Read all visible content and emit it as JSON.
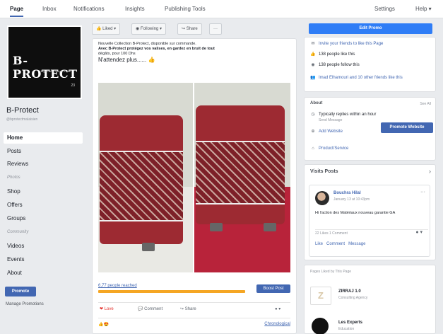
{
  "tabs": {
    "page": "Page",
    "inbox": "Inbox",
    "notifications": "Notifications",
    "insights": "Insights",
    "publishing_tools": "Publishing Tools",
    "settings": "Settings",
    "help": "Help"
  },
  "sidebar": {
    "logo_text": "B- PROTECT",
    "logo_tagline": "Huge Carry, Huge Travel",
    "logo_number": "23",
    "page_name": "B-Protect",
    "page_handle": "@bprotectmalaisien",
    "items": [
      {
        "label": "Home"
      },
      {
        "label": "Posts"
      },
      {
        "label": "Reviews"
      },
      {
        "label": "Photos"
      },
      {
        "label": "Shop"
      },
      {
        "label": "Offers"
      },
      {
        "label": "Groups"
      },
      {
        "label": "Community"
      },
      {
        "label": "Videos"
      },
      {
        "label": "Events"
      },
      {
        "label": "About"
      }
    ],
    "promote_label": "Promote",
    "manage_label": "Manage Promotions"
  },
  "action_bar": {
    "liked": "Liked",
    "following": "Following",
    "share": "Share",
    "more": "···"
  },
  "post": {
    "text_line1": "Nouvelle Collection B-Protect, disponible sur commande.",
    "text_line2": "Avec B-Protect protégez vos valises, en gardez en bruit de tout",
    "text_line3": "dégâts, pour 100 Dhs",
    "text_line4": "N'attendez plus...... 👍",
    "reach_text": "6,77 people reached",
    "reach_percent": 0.93,
    "boost_label": "Boost Post",
    "like_label": "Love",
    "comment_label": "Comment",
    "share_label": "Share",
    "reactions": "👍😍",
    "commented_label": "Chronological"
  },
  "right": {
    "create_label": "Edit Promo",
    "invite_label": "Invite your friends to like this Page",
    "likes_count": "138 people like this",
    "follows_count": "138 people follow this",
    "friends_like": "Imad Elhamouri and 10 other friends like this",
    "about_title": "About",
    "see_all": "See All",
    "response_time": "Typically replies within an hour",
    "send_message": "Send Message",
    "add_website": "Add Website",
    "promote_website": "Promote Website",
    "product_service": "Product/Service",
    "visits_title": "Visits Posts",
    "visitor_name": "Bouchra Hilal",
    "visitor_date": "January 13 at 10:43pm",
    "visitor_text": "Hi l'action des Matériaux nouveau garantie GA",
    "visitor_stats": "22 Likes  1 Comment",
    "visitor_like": "Like",
    "visitor_comment": "Comment",
    "visitor_message": "Message",
    "pages_liked_title": "Pages Liked by This Page",
    "page1_name": "ZIRRAJ 1.0",
    "page1_sub": "Consulting Agency",
    "page2_name": "Les Experts",
    "page2_sub": "Education"
  },
  "colors": {
    "accent": "#4267b2",
    "create_blue": "#2f7df6",
    "reach_orange": "#f5a623",
    "case_red": "#9d2a32"
  }
}
